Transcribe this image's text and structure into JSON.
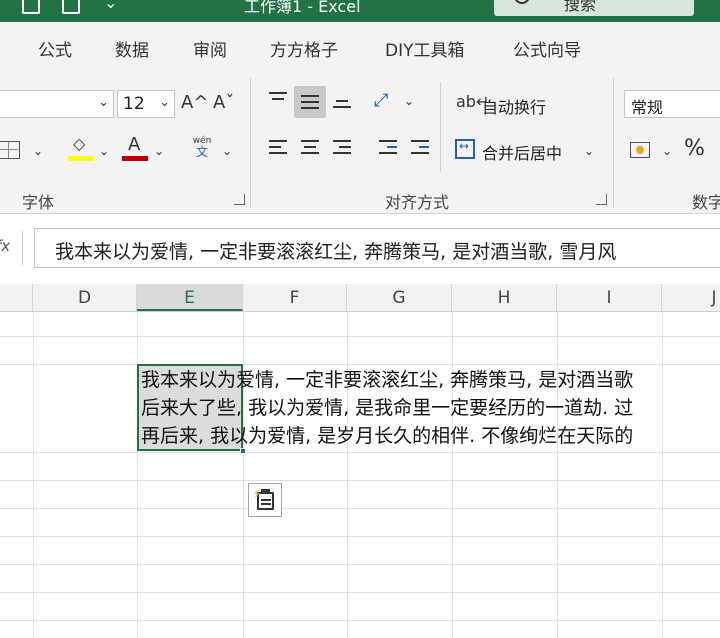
{
  "titlebar": {
    "title": "工作簿1 - Excel",
    "search_label": "搜索",
    "bg_color": "#217346"
  },
  "tabs": [
    "公式",
    "数据",
    "审阅",
    "方方格子",
    "DIY工具箱",
    "公式向导"
  ],
  "ribbon": {
    "font_group": {
      "font_size": "12",
      "grow_icon": "A^",
      "shrink_icon": "Aˇ",
      "label": "字体",
      "wen_top": "wén",
      "wen_bottom": "文"
    },
    "align_group": {
      "wrap_label": "自动换行",
      "merge_label": "合并后居中",
      "label": "对齐方式"
    },
    "number_group": {
      "format_value": "常规",
      "percent": "%",
      "label": "数字"
    }
  },
  "formula_bar": {
    "fx_label": "fx",
    "content": "我本来以为爱情, 一定非要滚滚红尘, 奔腾策马, 是对酒当歌, 雪月风"
  },
  "grid": {
    "columns": [
      "D",
      "E",
      "F",
      "G",
      "H",
      "I",
      "J"
    ],
    "selected_column": "E",
    "cell_lines": [
      "我本来以为爱情, 一定非要滚滚红尘, 奔腾策马, 是对酒当歌",
      "后来大了些, 我以为爱情, 是我命里一定要经历的一道劫. 过",
      "再后来, 我以为爱情, 是岁月长久的相伴. 不像绚烂在天际的"
    ],
    "accent_color": "#217346"
  }
}
